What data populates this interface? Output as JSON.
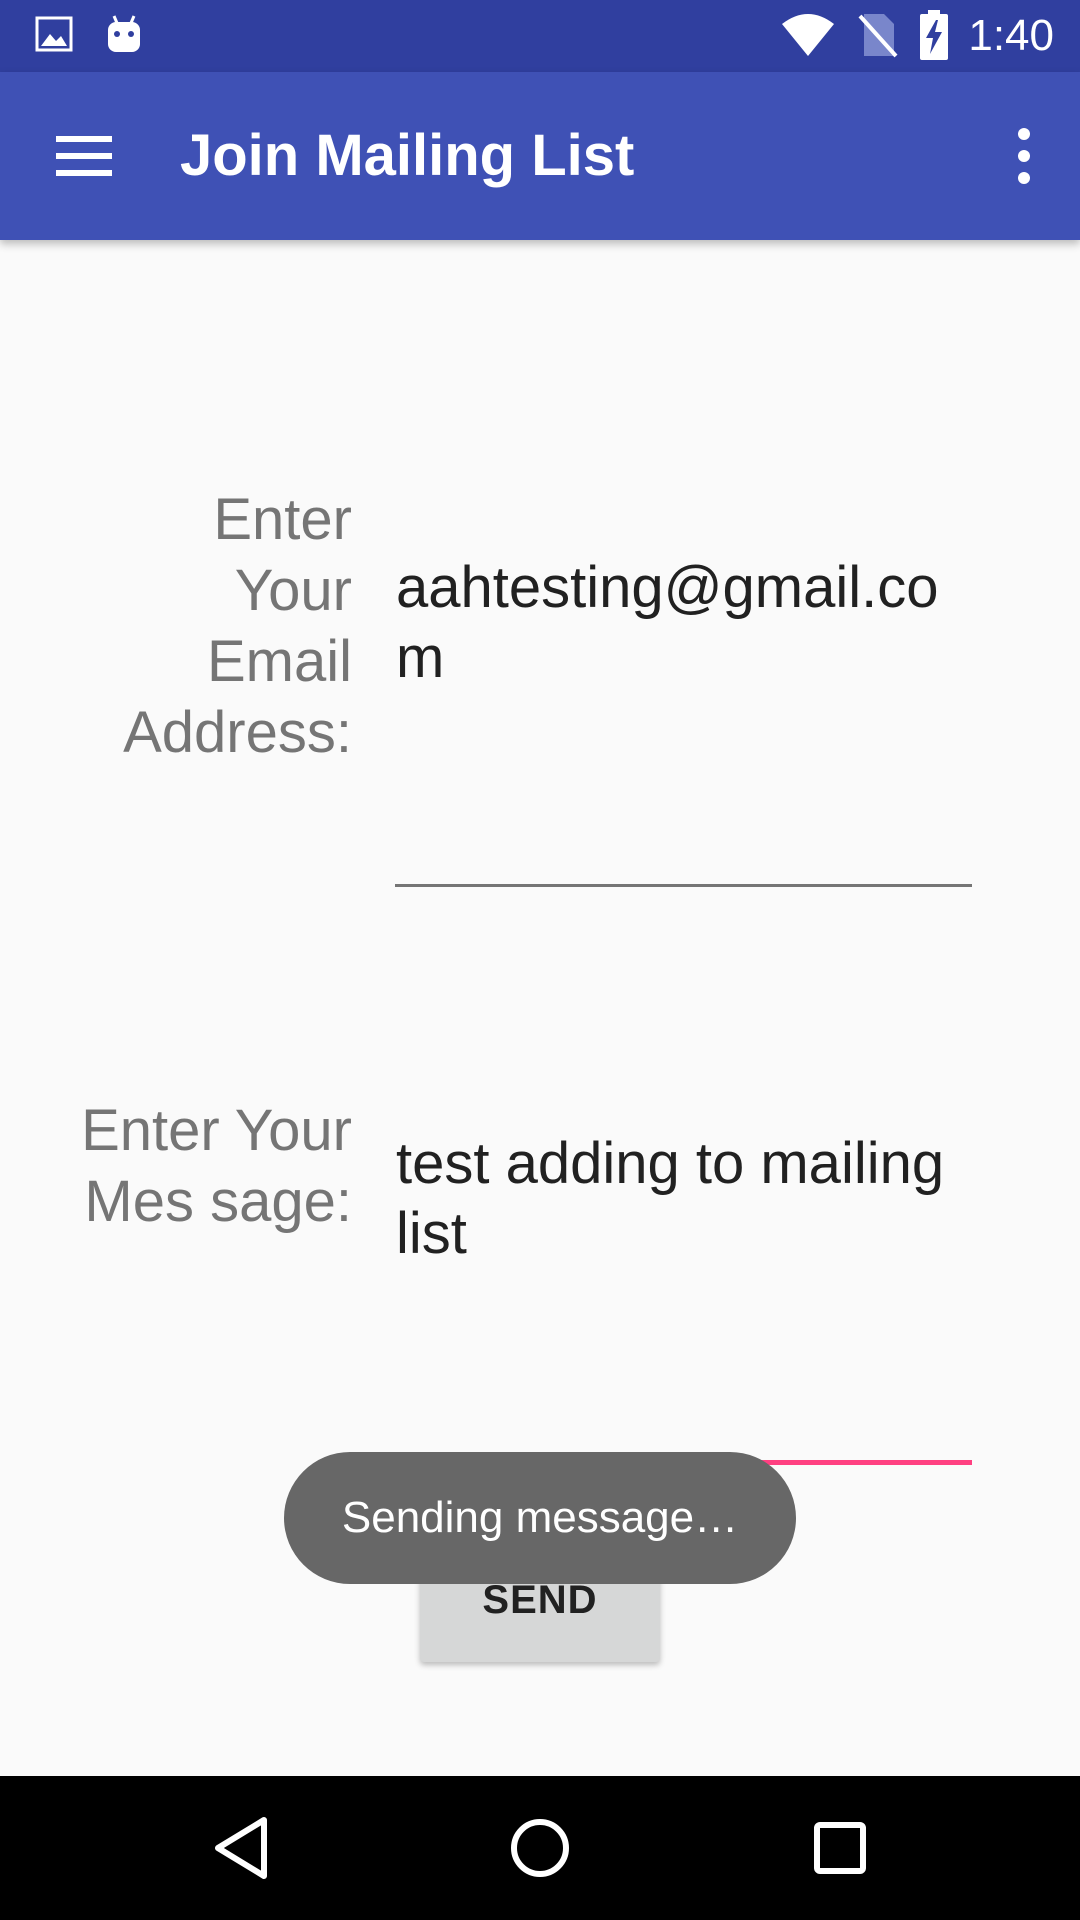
{
  "status_bar": {
    "time": "1:40",
    "icons": [
      "image-icon",
      "android-icon",
      "wifi-icon",
      "no-sim-icon",
      "battery-charging-icon"
    ]
  },
  "app_bar": {
    "title": "Join Mailing List",
    "menu_icon": "hamburger-menu-icon",
    "overflow_icon": "more-vert-icon",
    "color": "#3f51b5"
  },
  "form": {
    "email_label": "Enter Your Email Address:",
    "email_value": "aahtesting@gmail.com",
    "message_label": "Enter Your Mes sage:",
    "message_value": "test adding to mailing list",
    "accent_color": "#ff4081"
  },
  "send_button": {
    "label": "SEND"
  },
  "toast": {
    "text": "Sending message…"
  },
  "nav_bar": {
    "icons": [
      "back-icon",
      "home-icon",
      "recents-icon"
    ]
  }
}
